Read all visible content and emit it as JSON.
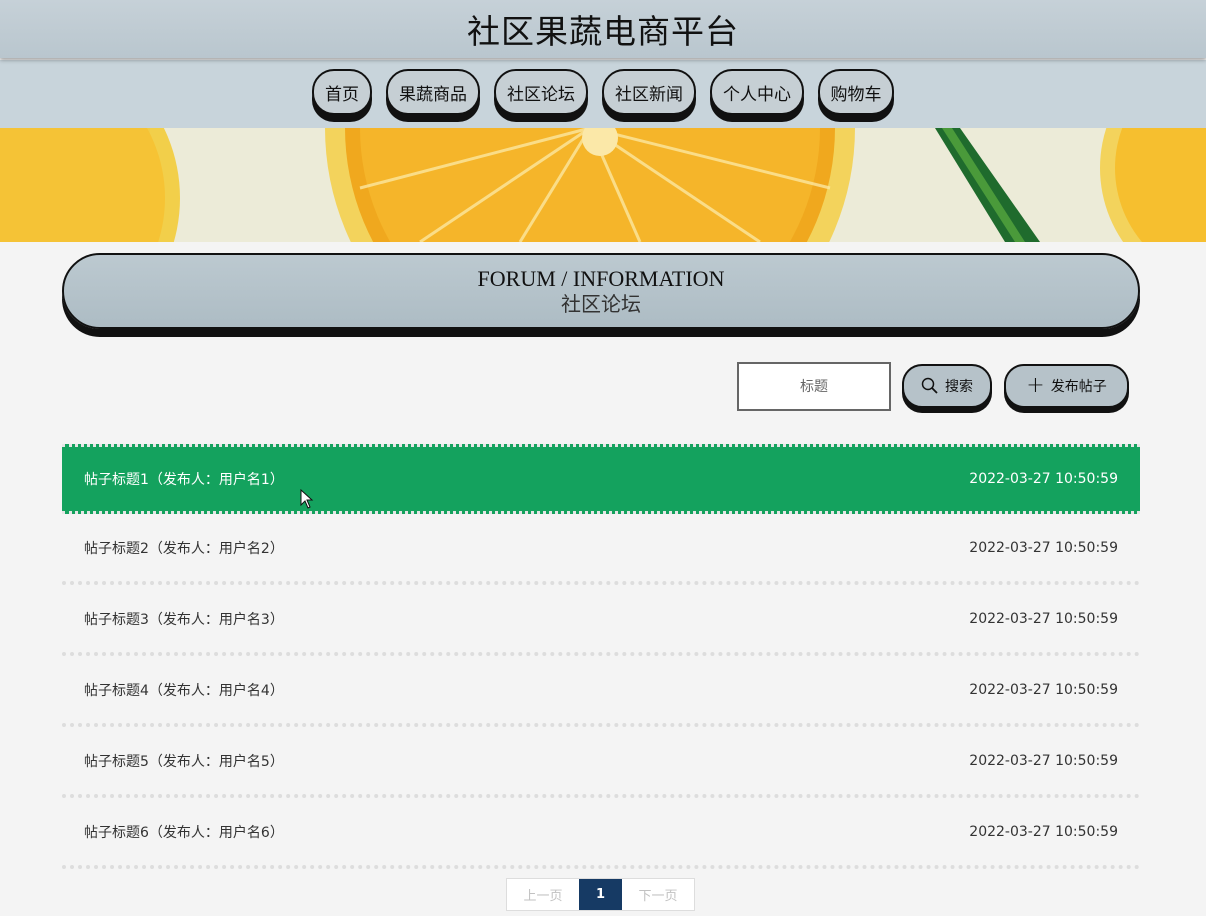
{
  "header": {
    "title": "社区果蔬电商平台"
  },
  "nav": {
    "items": [
      {
        "label": "首页"
      },
      {
        "label": "果蔬商品"
      },
      {
        "label": "社区论坛"
      },
      {
        "label": "社区新闻"
      },
      {
        "label": "个人中心"
      },
      {
        "label": "购物车"
      }
    ]
  },
  "forum": {
    "title_en": "FORUM / INFORMATION",
    "title_zh": "社区论坛"
  },
  "search": {
    "placeholder": "标题",
    "button_label": "搜索",
    "post_button_label": "发布帖子"
  },
  "posts": [
    {
      "title": "帖子标题1（发布人：用户名1）",
      "time": "2022-03-27 10:50:59"
    },
    {
      "title": "帖子标题2（发布人：用户名2）",
      "time": "2022-03-27 10:50:59"
    },
    {
      "title": "帖子标题3（发布人：用户名3）",
      "time": "2022-03-27 10:50:59"
    },
    {
      "title": "帖子标题4（发布人：用户名4）",
      "time": "2022-03-27 10:50:59"
    },
    {
      "title": "帖子标题5（发布人：用户名5）",
      "time": "2022-03-27 10:50:59"
    },
    {
      "title": "帖子标题6（发布人：用户名6）",
      "time": "2022-03-27 10:50:59"
    }
  ],
  "pagination": {
    "prev": "上一页",
    "current": "1",
    "next": "下一页"
  },
  "colors": {
    "active_row": "#14a25e",
    "page_current": "#163a64",
    "header_bg": "#c6d1d8"
  }
}
